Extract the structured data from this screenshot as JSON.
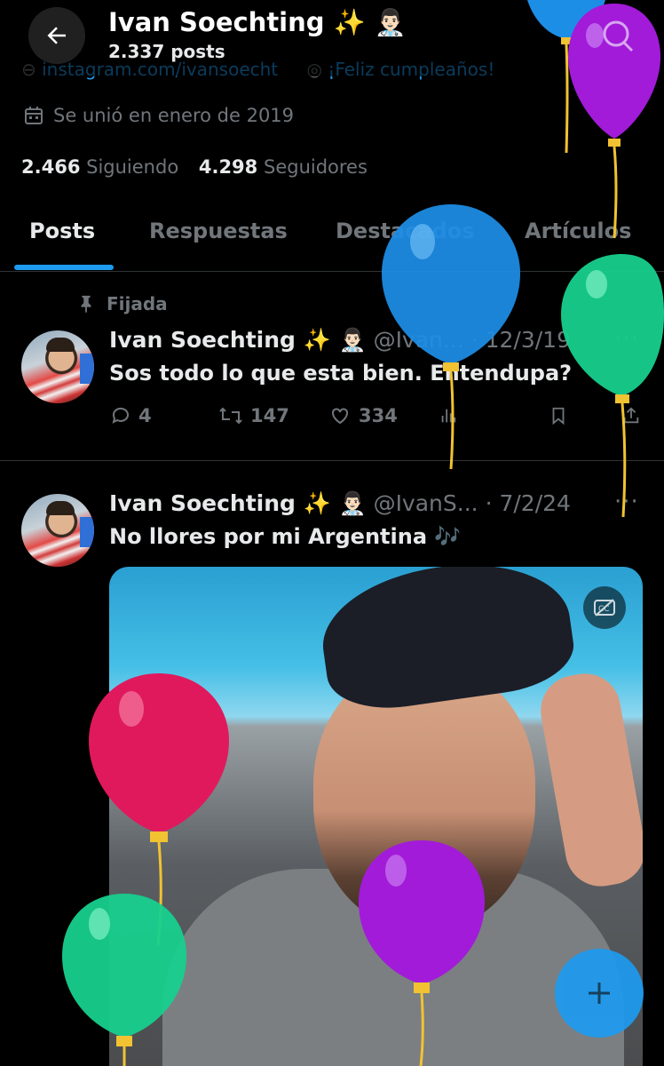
{
  "header": {
    "name": "Ivan Soechting ✨ 👨🏻‍⚕️",
    "post_count": "2.337 posts"
  },
  "profile": {
    "link_partial": "instagram.com/ivansoecht",
    "birthday_partial": "¡Feliz cumpleaños!",
    "joined": "Se unió en enero de 2019",
    "following_count": "2.466",
    "following_label": "Siguiendo",
    "followers_count": "4.298",
    "followers_label": "Seguidores"
  },
  "tabs": [
    {
      "label": "Posts"
    },
    {
      "label": "Respuestas"
    },
    {
      "label": "Destacados"
    },
    {
      "label": "Artículos"
    }
  ],
  "posts": [
    {
      "pinned_label": "Fijada",
      "author": "Ivan Soechting ✨ 👨🏻‍⚕️",
      "handle": "@Ivan...",
      "date": "· 12/3/19",
      "text": "Sos todo lo que esta bien. Entendupa?",
      "replies": "4",
      "reposts": "147",
      "likes": "334"
    },
    {
      "author": "Ivan Soechting ✨ 👨🏻‍⚕️",
      "handle": "@IvanS...",
      "date": "· 7/2/24",
      "text": "No llores por mi Argentina 🎶"
    }
  ],
  "colors": {
    "accent": "#1d9bf0",
    "muted": "#71767b",
    "balloon_blue": "#1d8ee6",
    "balloon_purple": "#a21bd9",
    "balloon_green": "#17d08d",
    "balloon_pink": "#e0195d"
  },
  "icons": [
    "back-arrow-icon",
    "search-icon",
    "location-icon",
    "calendar-icon",
    "pin-icon",
    "reply-icon",
    "repost-icon",
    "like-icon",
    "views-icon",
    "bookmark-icon",
    "share-icon",
    "more-icon",
    "captions-off-icon",
    "plus-icon"
  ]
}
